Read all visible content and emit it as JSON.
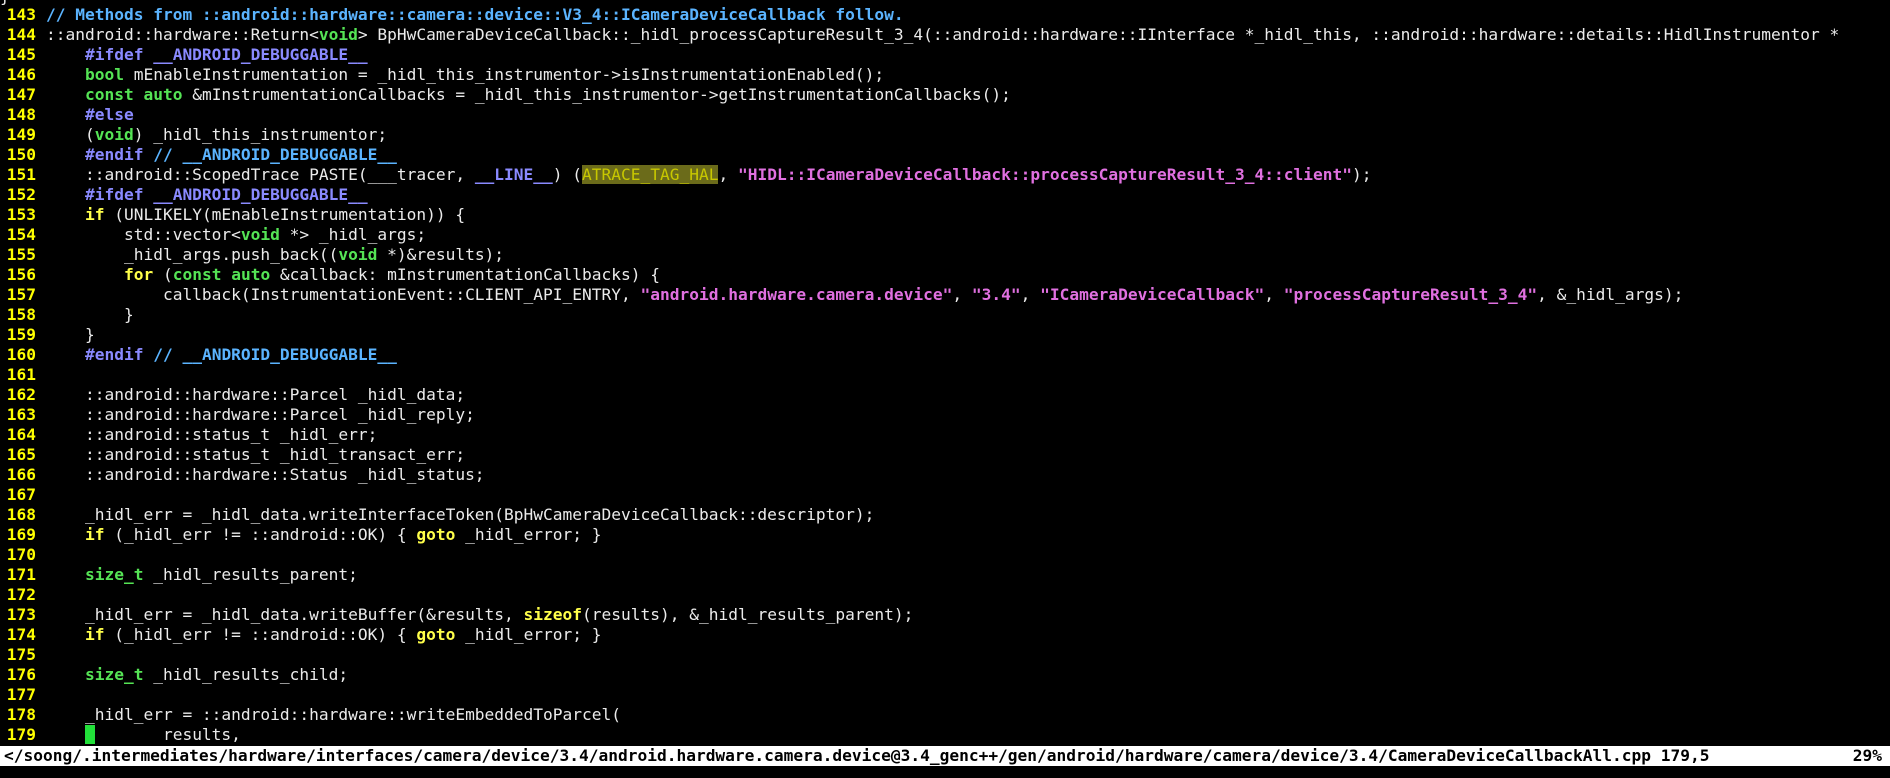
{
  "colors": {
    "background": "#000000",
    "line_number": "#ffff00",
    "comment": "#5bb4ff",
    "preprocessor": "#8a8aff",
    "keyword": "#ffff4a",
    "type": "#55e455",
    "string": "#e070e0",
    "search_highlight": "#6b6b1a",
    "cursor": "#22e03a",
    "statusline_bg": "#ffffff"
  },
  "editor": {
    "top_edge_text": "}",
    "lines": [
      {
        "num": "143",
        "tokens": [
          [
            "comment",
            "// Methods from ::android::hardware::camera::device::V3_4::ICameraDeviceCallback follow."
          ]
        ]
      },
      {
        "num": "144",
        "tokens": [
          [
            "plain",
            "::android::hardware::Return<"
          ],
          [
            "type",
            "void"
          ],
          [
            "plain",
            "> BpHwCameraDeviceCallback::_hidl_processCaptureResult_3_4(::android::hardware::IInterface *_hidl_this, ::android::hardware::details::HidlInstrumentor *"
          ]
        ]
      },
      {
        "num": "145",
        "tokens": [
          [
            "plain",
            "    "
          ],
          [
            "preproc",
            "#ifdef __ANDROID_DEBUGGABLE__"
          ]
        ]
      },
      {
        "num": "146",
        "tokens": [
          [
            "plain",
            "    "
          ],
          [
            "type",
            "bool"
          ],
          [
            "plain",
            " mEnableInstrumentation = _hidl_this_instrumentor->isInstrumentationEnabled();"
          ]
        ]
      },
      {
        "num": "147",
        "tokens": [
          [
            "plain",
            "    "
          ],
          [
            "type",
            "const"
          ],
          [
            "plain",
            " "
          ],
          [
            "type",
            "auto"
          ],
          [
            "plain",
            " &mInstrumentationCallbacks = _hidl_this_instrumentor->getInstrumentationCallbacks();"
          ]
        ]
      },
      {
        "num": "148",
        "tokens": [
          [
            "plain",
            "    "
          ],
          [
            "preproc",
            "#else"
          ]
        ]
      },
      {
        "num": "149",
        "tokens": [
          [
            "plain",
            "    ("
          ],
          [
            "type",
            "void"
          ],
          [
            "plain",
            ") _hidl_this_instrumentor;"
          ]
        ]
      },
      {
        "num": "150",
        "tokens": [
          [
            "plain",
            "    "
          ],
          [
            "preproc",
            "#endif"
          ],
          [
            "plain",
            " "
          ],
          [
            "comment",
            "// __ANDROID_DEBUGGABLE__"
          ]
        ]
      },
      {
        "num": "151",
        "tokens": [
          [
            "plain",
            "    ::android::ScopedTrace PASTE(___tracer, "
          ],
          [
            "preproc",
            "__LINE__"
          ],
          [
            "plain",
            ") ("
          ],
          [
            "search",
            "ATRACE_TAG_HAL"
          ],
          [
            "plain",
            ", "
          ],
          [
            "string",
            "\"HIDL::ICameraDeviceCallback::processCaptureResult_3_4::client\""
          ],
          [
            "plain",
            ");"
          ]
        ]
      },
      {
        "num": "152",
        "tokens": [
          [
            "plain",
            "    "
          ],
          [
            "preproc",
            "#ifdef __ANDROID_DEBUGGABLE__"
          ]
        ]
      },
      {
        "num": "153",
        "tokens": [
          [
            "plain",
            "    "
          ],
          [
            "keyword",
            "if"
          ],
          [
            "plain",
            " (UNLIKELY(mEnableInstrumentation)) {"
          ]
        ]
      },
      {
        "num": "154",
        "tokens": [
          [
            "plain",
            "        std::vector<"
          ],
          [
            "type",
            "void"
          ],
          [
            "plain",
            " *> _hidl_args;"
          ]
        ]
      },
      {
        "num": "155",
        "tokens": [
          [
            "plain",
            "        _hidl_args.push_back(("
          ],
          [
            "type",
            "void"
          ],
          [
            "plain",
            " *)&results);"
          ]
        ]
      },
      {
        "num": "156",
        "tokens": [
          [
            "plain",
            "        "
          ],
          [
            "keyword",
            "for"
          ],
          [
            "plain",
            " ("
          ],
          [
            "type",
            "const"
          ],
          [
            "plain",
            " "
          ],
          [
            "type",
            "auto"
          ],
          [
            "plain",
            " &callback: mInstrumentationCallbacks) {"
          ]
        ]
      },
      {
        "num": "157",
        "tokens": [
          [
            "plain",
            "            callback(InstrumentationEvent::CLIENT_API_ENTRY, "
          ],
          [
            "string",
            "\"android.hardware.camera.device\""
          ],
          [
            "plain",
            ", "
          ],
          [
            "string",
            "\"3.4\""
          ],
          [
            "plain",
            ", "
          ],
          [
            "string",
            "\"ICameraDeviceCallback\""
          ],
          [
            "plain",
            ", "
          ],
          [
            "string",
            "\"processCaptureResult_3_4\""
          ],
          [
            "plain",
            ", &_hidl_args);"
          ]
        ]
      },
      {
        "num": "158",
        "tokens": [
          [
            "plain",
            "        }"
          ]
        ]
      },
      {
        "num": "159",
        "tokens": [
          [
            "plain",
            "    }"
          ]
        ]
      },
      {
        "num": "160",
        "tokens": [
          [
            "plain",
            "    "
          ],
          [
            "preproc",
            "#endif"
          ],
          [
            "plain",
            " "
          ],
          [
            "comment",
            "// __ANDROID_DEBUGGABLE__"
          ]
        ]
      },
      {
        "num": "161",
        "tokens": []
      },
      {
        "num": "162",
        "tokens": [
          [
            "plain",
            "    ::android::hardware::Parcel _hidl_data;"
          ]
        ]
      },
      {
        "num": "163",
        "tokens": [
          [
            "plain",
            "    ::android::hardware::Parcel _hidl_reply;"
          ]
        ]
      },
      {
        "num": "164",
        "tokens": [
          [
            "plain",
            "    ::android::status_t _hidl_err;"
          ]
        ]
      },
      {
        "num": "165",
        "tokens": [
          [
            "plain",
            "    ::android::status_t _hidl_transact_err;"
          ]
        ]
      },
      {
        "num": "166",
        "tokens": [
          [
            "plain",
            "    ::android::hardware::Status _hidl_status;"
          ]
        ]
      },
      {
        "num": "167",
        "tokens": []
      },
      {
        "num": "168",
        "tokens": [
          [
            "plain",
            "    _hidl_err = _hidl_data.writeInterfaceToken(BpHwCameraDeviceCallback::descriptor);"
          ]
        ]
      },
      {
        "num": "169",
        "tokens": [
          [
            "plain",
            "    "
          ],
          [
            "keyword",
            "if"
          ],
          [
            "plain",
            " (_hidl_err != ::android::OK) { "
          ],
          [
            "keyword",
            "goto"
          ],
          [
            "plain",
            " _hidl_error; }"
          ]
        ]
      },
      {
        "num": "170",
        "tokens": []
      },
      {
        "num": "171",
        "tokens": [
          [
            "plain",
            "    "
          ],
          [
            "type",
            "size_t"
          ],
          [
            "plain",
            " _hidl_results_parent;"
          ]
        ]
      },
      {
        "num": "172",
        "tokens": []
      },
      {
        "num": "173",
        "tokens": [
          [
            "plain",
            "    _hidl_err = _hidl_data.writeBuffer(&results, "
          ],
          [
            "keyword",
            "sizeof"
          ],
          [
            "plain",
            "(results), &_hidl_results_parent);"
          ]
        ]
      },
      {
        "num": "174",
        "tokens": [
          [
            "plain",
            "    "
          ],
          [
            "keyword",
            "if"
          ],
          [
            "plain",
            " (_hidl_err != ::android::OK) { "
          ],
          [
            "keyword",
            "goto"
          ],
          [
            "plain",
            " _hidl_error; }"
          ]
        ]
      },
      {
        "num": "175",
        "tokens": []
      },
      {
        "num": "176",
        "tokens": [
          [
            "plain",
            "    "
          ],
          [
            "type",
            "size_t"
          ],
          [
            "plain",
            " _hidl_results_child;"
          ]
        ]
      },
      {
        "num": "177",
        "tokens": []
      },
      {
        "num": "178",
        "tokens": [
          [
            "plain",
            "    _hidl_err = ::android::hardware::writeEmbeddedToParcel("
          ]
        ]
      },
      {
        "num": "179",
        "tokens": [
          [
            "plain",
            "    "
          ],
          [
            "cursor",
            " "
          ],
          [
            "plain",
            "       results,"
          ]
        ]
      }
    ]
  },
  "statusline": {
    "file": "</soong/.intermediates/hardware/interfaces/camera/device/3.4/android.hardware.camera.device@3.4_genc++/gen/android/hardware/camera/device/3.4/CameraDeviceCallbackAll.cpp 179,5",
    "percent": "29%"
  }
}
